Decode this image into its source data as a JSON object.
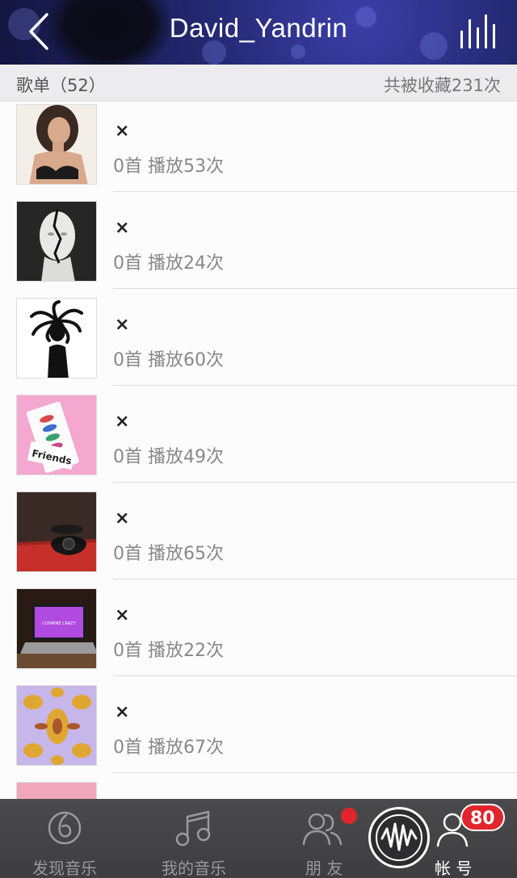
{
  "header": {
    "title": "David_Yandrin",
    "back_icon": "chevron-left-icon",
    "right_icon": "equalizer-bars-icon"
  },
  "section": {
    "left_label": "歌单（52）",
    "right_label": "共被收藏231次"
  },
  "playlists": [
    {
      "title": "×",
      "meta": "0首 播放53次",
      "cover": "portrait-woman"
    },
    {
      "title": "×",
      "meta": "0首 播放24次",
      "cover": "sculpture-head"
    },
    {
      "title": "×",
      "meta": "0首 播放60次",
      "cover": "medusa-statue"
    },
    {
      "title": "×",
      "meta": "0首 播放49次",
      "cover": "friends-pink-box"
    },
    {
      "title": "×",
      "meta": "0首 播放65次",
      "cover": "rotary-phone"
    },
    {
      "title": "×",
      "meta": "0首 播放22次",
      "cover": "laptop-purple"
    },
    {
      "title": "×",
      "meta": "0首 播放67次",
      "cover": "kaleidoscope"
    },
    {
      "title": "",
      "meta": "",
      "cover": "pink-partial"
    }
  ],
  "cover_text": {
    "friends": "Friends",
    "laptop": "COSMINE CRAZY"
  },
  "tabbar": {
    "tabs": [
      {
        "label": "发现音乐",
        "icon": "discover-music-icon"
      },
      {
        "label": "我的音乐",
        "icon": "music-note-icon"
      },
      {
        "label": "朋 友",
        "icon": "friends-icon"
      },
      {
        "label": "帐 号",
        "icon": "account-icon"
      }
    ],
    "account_badge": "80",
    "center_button_icon": "waveform-logo-icon"
  },
  "colors": {
    "badge": "#e0262c",
    "header_bg": "#22276e",
    "tabbar_bg": "#444446"
  }
}
